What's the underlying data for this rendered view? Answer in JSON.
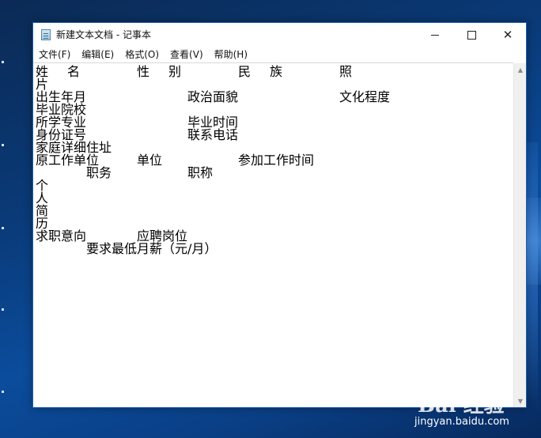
{
  "window": {
    "title": "新建文本文档 - 记事本",
    "controls": {
      "minimize": "—",
      "maximize": "□",
      "close": "✕"
    }
  },
  "menu": {
    "file": "文件(F)",
    "edit": "编辑(E)",
    "format": "格式(O)",
    "view": "查看(V)",
    "help": "帮助(H)"
  },
  "content": {
    "line1": {
      "a": "姓",
      "b": "名",
      "c": "性",
      "d": "别",
      "e": "民",
      "f": "族",
      "g": "照"
    },
    "line2": "片",
    "line3": {
      "a": "出生年月",
      "b": "政治面貌",
      "c": "文化程度"
    },
    "line4": "毕业院校",
    "line5": {
      "a": "所学专业",
      "b": "毕业时间"
    },
    "line6": {
      "a": "身份证号",
      "b": "联系电话"
    },
    "line7": "家庭详细住址",
    "line8": {
      "a": "原工作单位",
      "b": "单位",
      "c": "参加工作时间"
    },
    "line9": {
      "a": "职务",
      "b": "职称"
    },
    "line10": "个",
    "line11": "人",
    "line12": "简",
    "line13": "历",
    "line14": {
      "a": "求职意向",
      "b": "应聘岗位"
    },
    "line15": "要求最低月薪（元/月）"
  },
  "scrollbar": {
    "up": "▲",
    "down": "▼"
  },
  "watermark": {
    "logo": "Bai 经验",
    "url": "jingyan.baidu.com"
  },
  "colors": {
    "desktop": "#0a3a78",
    "window_border": "#1c5fb0",
    "text": "#000000"
  }
}
